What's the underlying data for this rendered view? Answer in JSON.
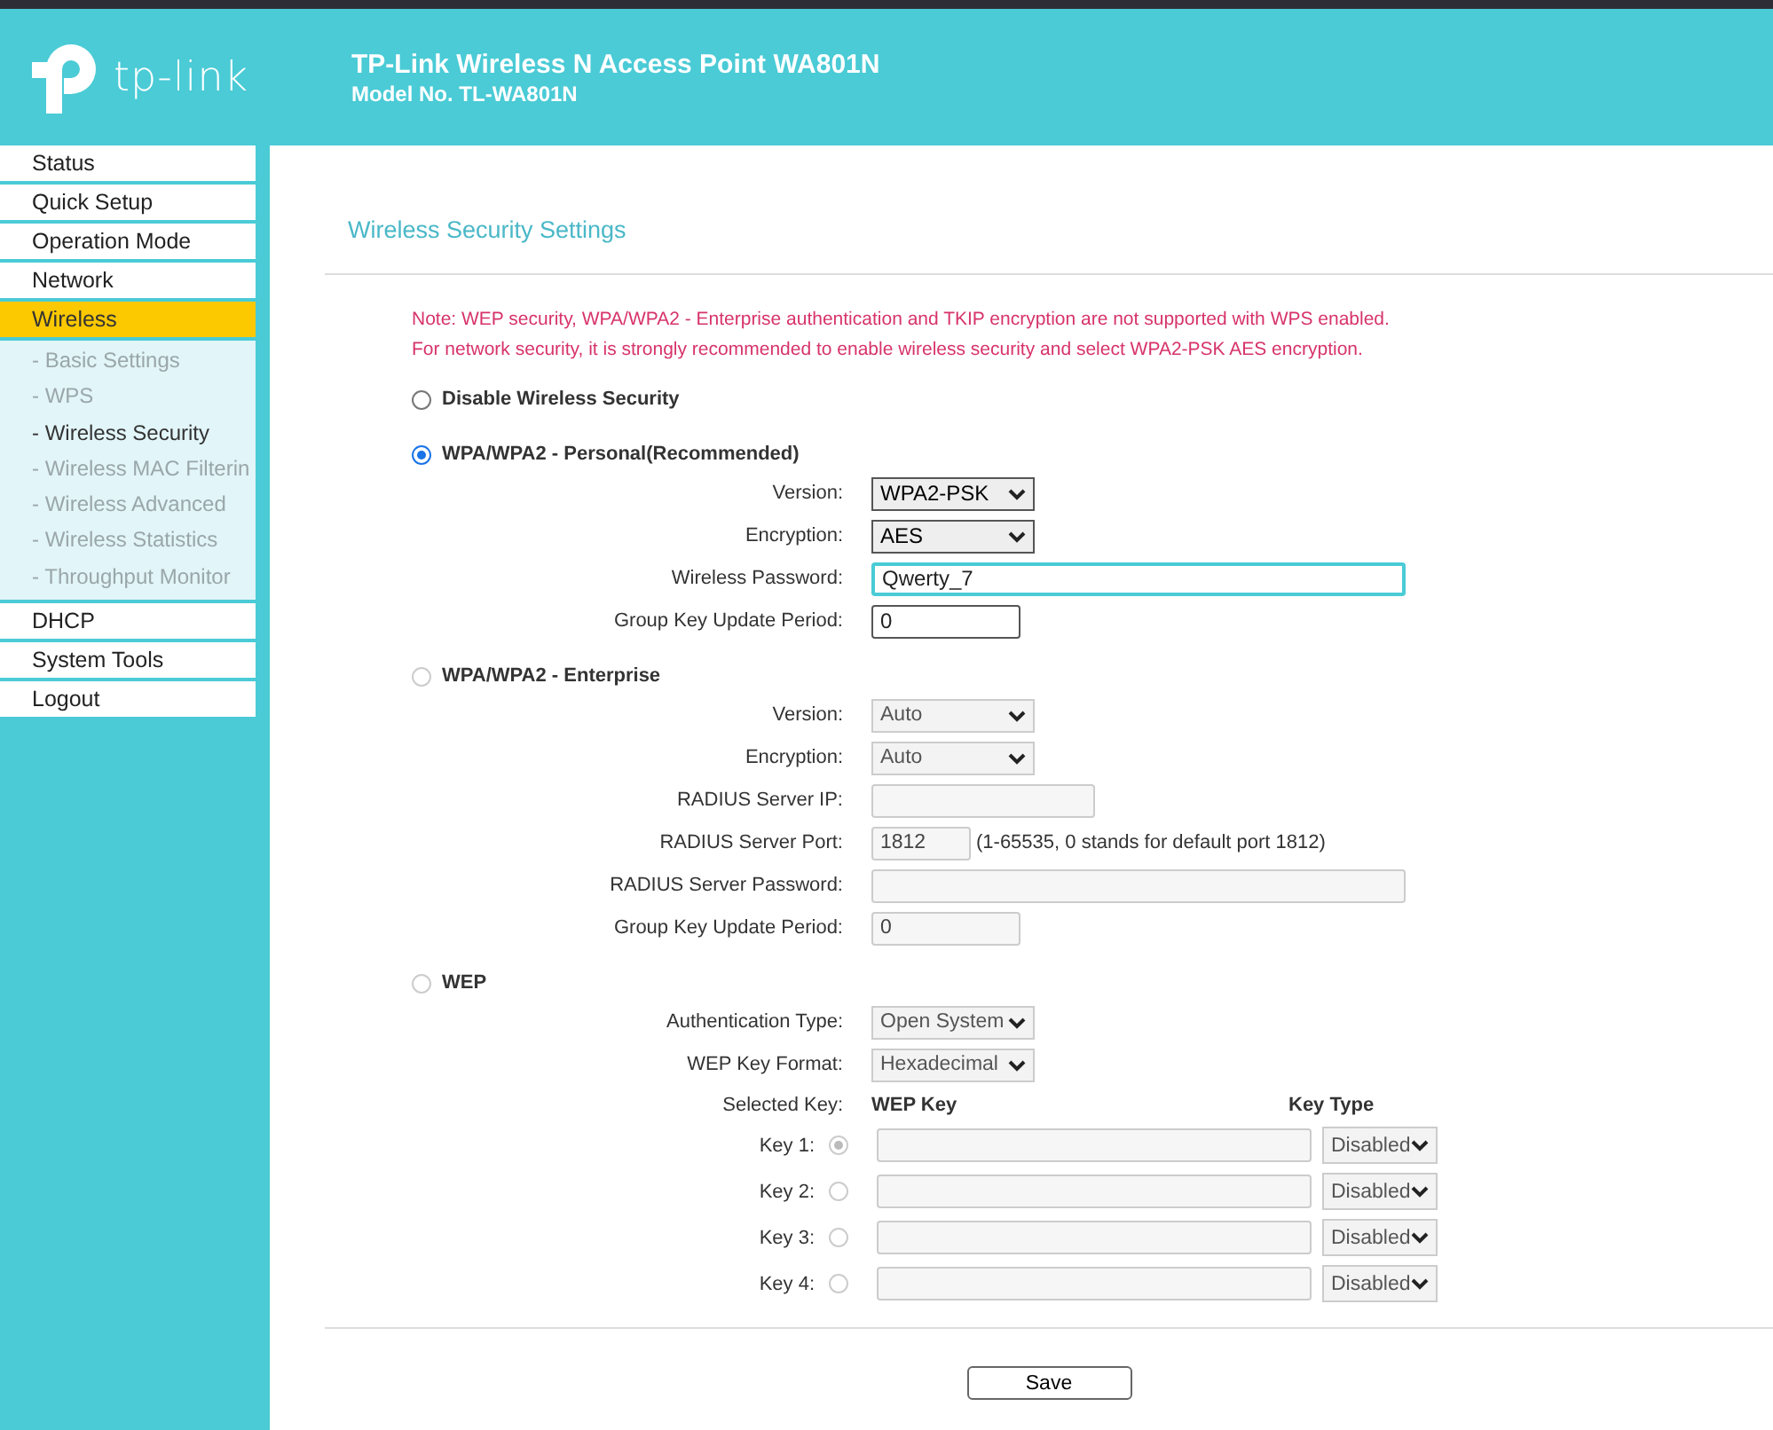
{
  "header": {
    "logo_text": "tp-link",
    "title": "TP-Link Wireless N Access Point WA801N",
    "model": "Model No. TL-WA801N"
  },
  "sidebar": {
    "items": [
      {
        "label": "Status",
        "selected": false
      },
      {
        "label": "Quick Setup",
        "selected": false
      },
      {
        "label": "Operation Mode",
        "selected": false
      },
      {
        "label": "Network",
        "selected": false
      },
      {
        "label": "Wireless",
        "selected": true,
        "children": [
          {
            "label": "- Basic Settings",
            "selected": false
          },
          {
            "label": "- WPS",
            "selected": false
          },
          {
            "label": "- Wireless Security",
            "selected": true
          },
          {
            "label": "- Wireless MAC Filterin",
            "selected": false
          },
          {
            "label": "- Wireless Advanced",
            "selected": false
          },
          {
            "label": "- Wireless Statistics",
            "selected": false
          },
          {
            "label": "- Throughput Monitor",
            "selected": false
          }
        ]
      },
      {
        "label": "DHCP",
        "selected": false
      },
      {
        "label": "System Tools",
        "selected": false
      },
      {
        "label": "Logout",
        "selected": false
      }
    ]
  },
  "page": {
    "title": "Wireless Security Settings",
    "notes": [
      "Note: WEP security, WPA/WPA2 - Enterprise authentication and TKIP encryption are not supported with WPS enabled.",
      "For network security, it is strongly recommended to enable wireless security and select WPA2-PSK AES encryption."
    ],
    "options": [
      {
        "label": "Disable Wireless Security",
        "selected": false,
        "disabled": false
      },
      {
        "label": "WPA/WPA2 - Personal(Recommended)",
        "selected": true,
        "disabled": false,
        "fields": [
          {
            "kind": "select",
            "label": "Version:",
            "value": "WPA2-PSK"
          },
          {
            "kind": "select",
            "label": "Encryption:",
            "value": "AES"
          },
          {
            "kind": "large",
            "label": "Wireless Password:",
            "value": "Qwerty_7",
            "focused": true
          },
          {
            "kind": "small",
            "label": "Group Key Update Period:",
            "value": "0",
            "focused": false
          }
        ]
      },
      {
        "label": "WPA/WPA2 - Enterprise",
        "selected": false,
        "disabled": true,
        "fields": [
          {
            "kind": "select",
            "label": "Version:",
            "value": "Auto"
          },
          {
            "kind": "select",
            "label": "Encryption:",
            "value": "Auto"
          },
          {
            "kind": "medium",
            "label": "RADIUS Server IP:",
            "focused": false
          },
          {
            "kind": "port",
            "label": "RADIUS Server Port:",
            "value": "1812",
            "hint": "(1-65535, 0 stands for default port 1812)",
            "focused": false
          },
          {
            "kind": "large",
            "label": "RADIUS Server Password:",
            "focused": false
          },
          {
            "kind": "small",
            "label": "Group Key Update Period:",
            "value": "0",
            "focused": false
          }
        ]
      },
      {
        "label": "WEP",
        "selected": false,
        "disabled": true,
        "fields": [
          {
            "kind": "select",
            "label": "Authentication Type:",
            "value": "Open System"
          },
          {
            "kind": "select",
            "label": "WEP Key Format:",
            "value": "Hexadecimal"
          }
        ],
        "keys": {
          "selected_label": "Selected Key:",
          "key_heading": "WEP Key",
          "type_heading": "Key Type",
          "rows": [
            {
              "label": "Key 1:",
              "selected": true,
              "type": "Disabled"
            },
            {
              "label": "Key 2:",
              "selected": false,
              "type": "Disabled"
            },
            {
              "label": "Key 3:",
              "selected": false,
              "type": "Disabled"
            },
            {
              "label": "Key 4:",
              "selected": false,
              "type": "Disabled"
            }
          ]
        }
      }
    ]
  },
  "save_button": "Save"
}
